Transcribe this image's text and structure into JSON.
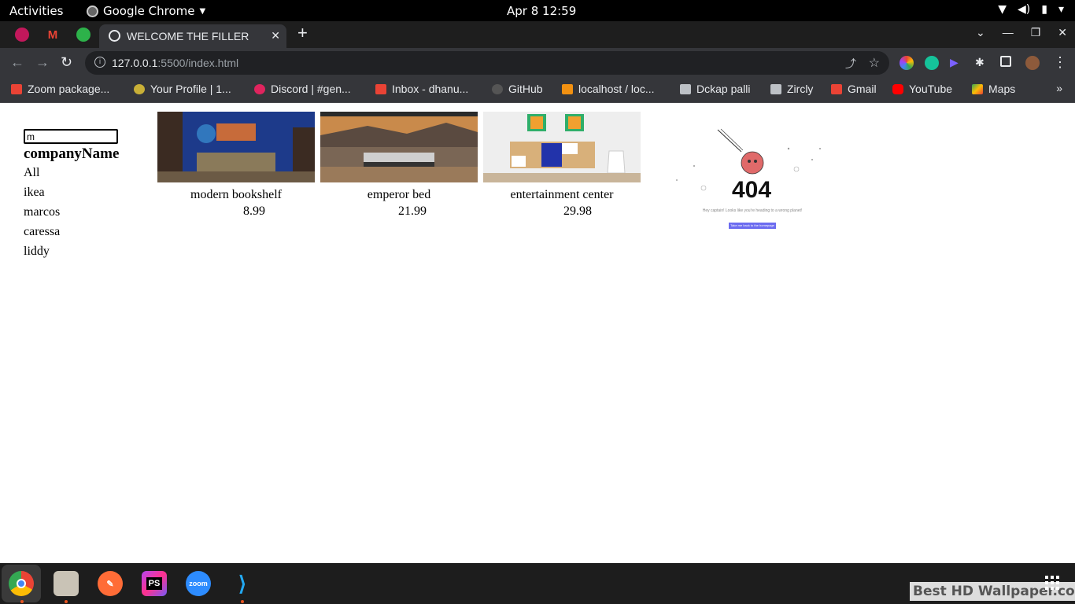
{
  "topbar": {
    "activities": "Activities",
    "app_name": "Google Chrome",
    "clock": "Apr 8  12:59"
  },
  "browser": {
    "tab_title": "WELCOME THE FILLER",
    "url_host": "127.0.0.1",
    "url_path": ":5500/index.html",
    "bookmarks": [
      {
        "label": "Zoom package...",
        "icon": "gmail-icon",
        "color": "#ea4335"
      },
      {
        "label": "Your Profile | 1...",
        "icon": "profile-icon",
        "color": "#c9b037"
      },
      {
        "label": "Discord | #gen...",
        "icon": "discord-icon",
        "color": "#e0245e"
      },
      {
        "label": "Inbox - dhanu...",
        "icon": "gmail-icon",
        "color": "#ea4335"
      },
      {
        "label": "GitHub",
        "icon": "github-icon",
        "color": "#333333"
      },
      {
        "label": "localhost / loc...",
        "icon": "phpmyadmin-icon",
        "color": "#f29111"
      },
      {
        "label": "Dckap palli",
        "icon": "folder-icon",
        "color": "#9aa0a6"
      },
      {
        "label": "Zircly",
        "icon": "folder-icon",
        "color": "#9aa0a6"
      },
      {
        "label": "Gmail",
        "icon": "gmail-icon",
        "color": "#ea4335"
      },
      {
        "label": "YouTube",
        "icon": "youtube-icon",
        "color": "#ff0000"
      },
      {
        "label": "Maps",
        "icon": "maps-icon",
        "color": "#34a853"
      }
    ]
  },
  "page": {
    "search_value": "m",
    "filter_heading": "companyName",
    "filters": [
      "All",
      "ikea",
      "marcos",
      "caressa",
      "liddy"
    ],
    "products": [
      {
        "name": "modern bookshelf",
        "price": "8.99",
        "image": "blue-room-photo"
      },
      {
        "name": "emperor bed",
        "price": "21.99",
        "image": "bedroom-photo"
      },
      {
        "name": "entertainment center",
        "price": "29.98",
        "image": "shelf-room-photo"
      }
    ],
    "error_image": {
      "code": "404",
      "message": "Hey captain! Looks like you're heading to a wrong planet!",
      "button": "Take me back to the homepage"
    }
  },
  "dock": {
    "apps": [
      "chrome-icon",
      "files-icon",
      "postman-icon",
      "phpstorm-icon",
      "zoom-icon",
      "vscode-icon"
    ],
    "zoom_label": "zoom",
    "phpstorm_label": "PS",
    "watermark": "Best HD Wallpaper.com"
  }
}
